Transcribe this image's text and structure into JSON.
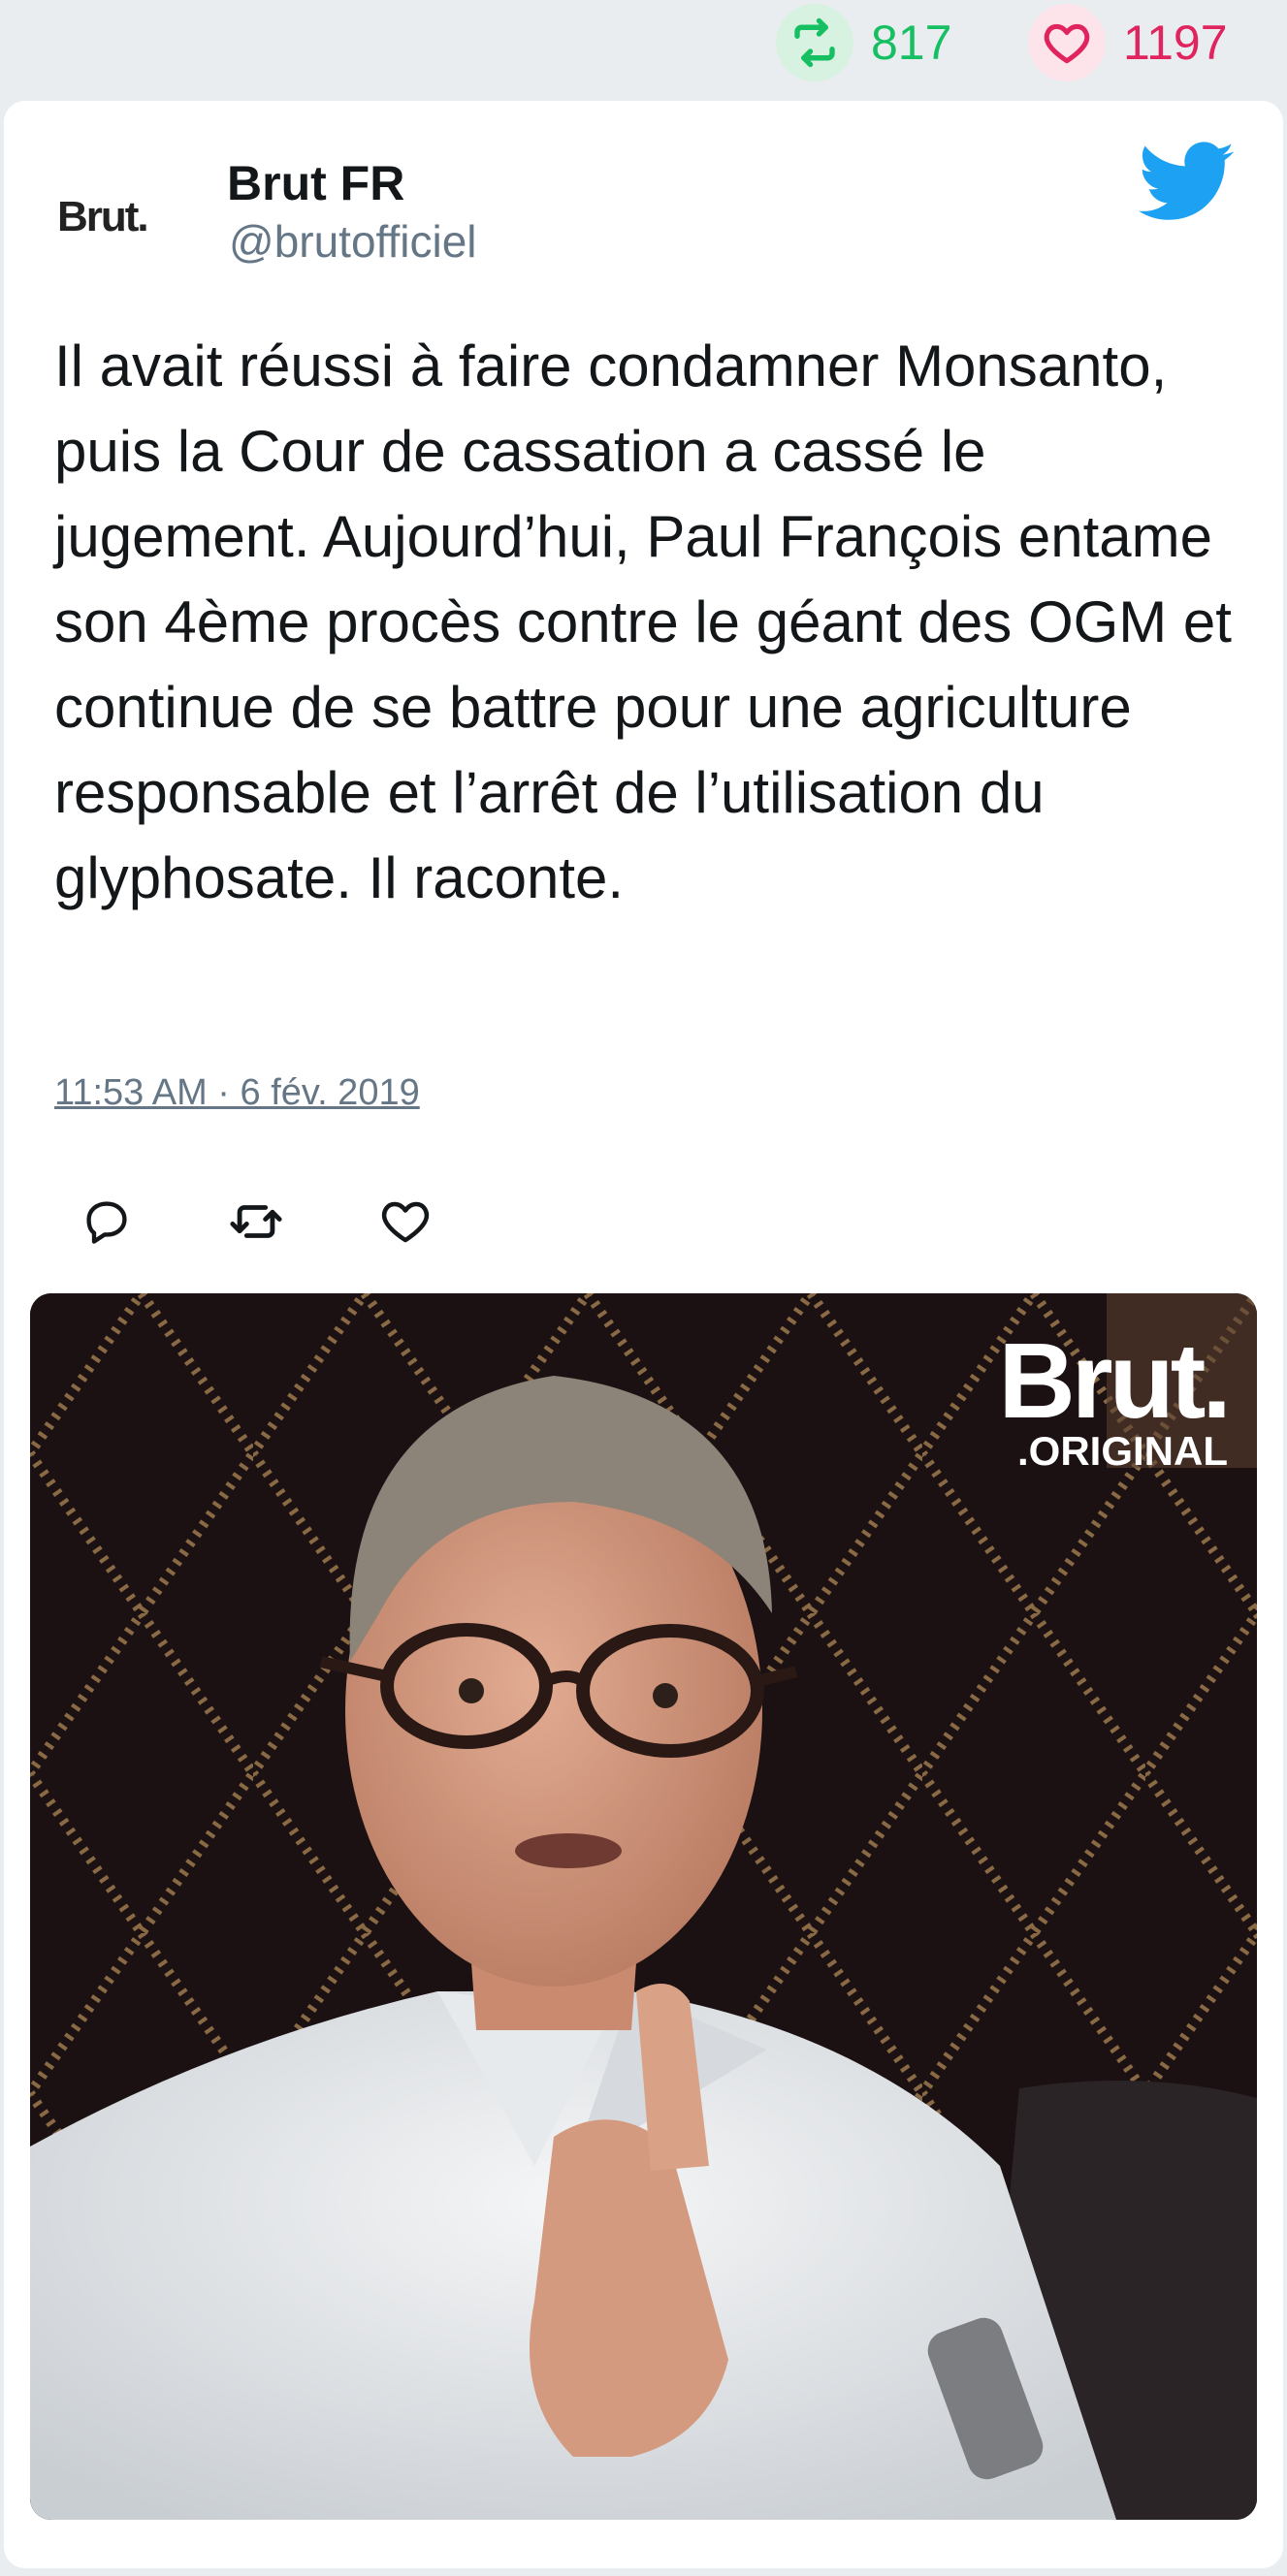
{
  "stats": {
    "retweet_count": "817",
    "like_count": "1197",
    "retweet_icon": "retweet-icon",
    "like_icon": "heart-icon"
  },
  "tweet": {
    "avatar_text": "Brut.",
    "display_name": "Brut FR",
    "handle": "@brutofficiel",
    "text": "Il avait réussi à faire condamner Monsanto, puis la Cour de cassation a cassé le jugement. Aujourd’hui, Paul François entame son 4ème procès contre le géant des OGM et continue de se battre pour une agriculture responsable et l’arrêt de l’utilisation du glyphosate. Il raconte.",
    "timestamp": "11:53 AM · 6 fév. 2019",
    "brand_icon": "twitter-bird-icon"
  },
  "actions": [
    {
      "name": "reply-button",
      "icon": "reply-icon"
    },
    {
      "name": "retweet-button",
      "icon": "retweet-icon"
    },
    {
      "name": "like-button",
      "icon": "heart-icon"
    }
  ],
  "media": {
    "logo_main": "Brut.",
    "logo_sub": ".ORIGINAL"
  },
  "colors": {
    "twitter_blue": "#1da1f2",
    "retweet_green": "#17bf63",
    "like_red": "#e0245e",
    "muted_gray": "#657786",
    "background": "#e9edf0"
  }
}
